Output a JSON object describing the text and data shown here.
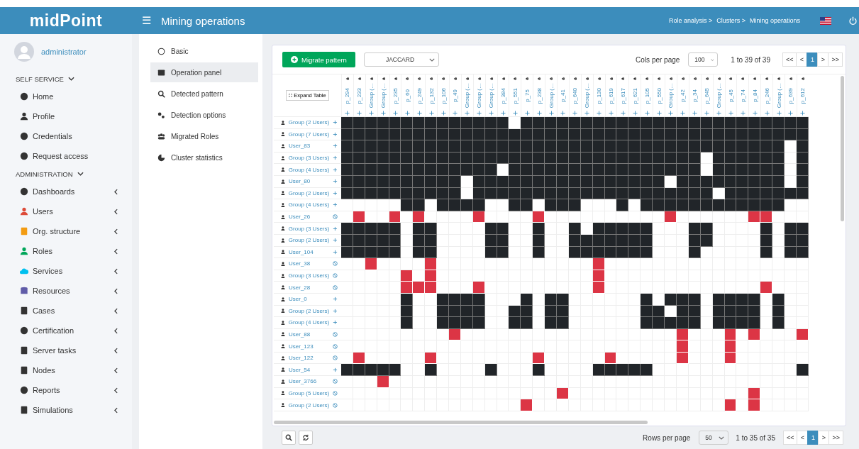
{
  "header": {
    "logo": "midPoint",
    "menu_icon": "☰",
    "title": "Mining operations",
    "breadcrumbs": [
      "Role analysis >",
      "Clusters >",
      "Mining operations"
    ]
  },
  "sidebar": {
    "user": "administrator",
    "sections": [
      {
        "title": "SELF SERVICE",
        "expanded": true,
        "items": [
          {
            "label": "Home",
            "has_submenu": false
          },
          {
            "label": "Profile",
            "has_submenu": false
          },
          {
            "label": "Credentials",
            "has_submenu": false
          },
          {
            "label": "Request access",
            "has_submenu": false
          }
        ]
      },
      {
        "title": "ADMINISTRATION",
        "expanded": true,
        "items": [
          {
            "label": "Dashboards",
            "has_submenu": true
          },
          {
            "label": "Users",
            "has_submenu": true
          },
          {
            "label": "Org. structure",
            "has_submenu": true
          },
          {
            "label": "Roles",
            "has_submenu": true
          },
          {
            "label": "Services",
            "has_submenu": true
          },
          {
            "label": "Resources",
            "has_submenu": true
          },
          {
            "label": "Cases",
            "has_submenu": true
          },
          {
            "label": "Certification",
            "has_submenu": true
          },
          {
            "label": "Server tasks",
            "has_submenu": true
          },
          {
            "label": "Nodes",
            "has_submenu": true
          },
          {
            "label": "Reports",
            "has_submenu": true
          },
          {
            "label": "Simulations",
            "has_submenu": true
          }
        ]
      }
    ]
  },
  "panel_menu": [
    {
      "label": "Basic",
      "selected": false
    },
    {
      "label": "Operation panel",
      "selected": true
    },
    {
      "label": "Detected pattern",
      "selected": false
    },
    {
      "label": "Detection options",
      "selected": false
    },
    {
      "label": "Migrated Roles",
      "selected": false
    },
    {
      "label": "Cluster statistics",
      "selected": false
    }
  ],
  "toolbar": {
    "migrate_button": "Migrate pattern",
    "similarity": "JACCARD",
    "cols_label": "Cols per page",
    "cols_value": "100",
    "range": "1 to 39 of 39",
    "pager": [
      {
        "label": "<<",
        "selected": false
      },
      {
        "label": "<",
        "selected": false
      },
      {
        "label": "1",
        "selected": true
      },
      {
        "label": ">",
        "selected": false
      },
      {
        "label": ">>",
        "selected": false
      }
    ]
  },
  "matrix": {
    "expand_button": "Expand Table",
    "columns": [
      "p_294",
      "p_233",
      "Group (…",
      "Group (…",
      "p_235",
      "p_60",
      "p_249",
      "p_132",
      "p_106",
      "p_49",
      "Group (…",
      "Group (…",
      "Group (…",
      "p_384",
      "p_551",
      "p_75",
      "p_238",
      "Group (…",
      "p_41",
      "p_640",
      "Group (…",
      "p_130",
      "p_619",
      "p_617",
      "p_621",
      "p_105",
      "p_550",
      "Group (…",
      "p_42",
      "p_34",
      "p_645",
      "Group (…",
      "p_45",
      "p_74",
      "p_84",
      "p_246",
      "Group (…",
      "p_639",
      "p_612"
    ],
    "rows": [
      {
        "label": "Group (2 Users)",
        "kind": "add",
        "cells": [
          true,
          true,
          true,
          true,
          true,
          true,
          true,
          true,
          true,
          true,
          true,
          true,
          true,
          true,
          false,
          true,
          true,
          true,
          true,
          true,
          true,
          true,
          true,
          true,
          true,
          true,
          true,
          true,
          true,
          true,
          true,
          true,
          true,
          true,
          true,
          true,
          true,
          true,
          true
        ]
      },
      {
        "label": "Group (7 Users)",
        "kind": "add",
        "cells": [
          true,
          true,
          true,
          true,
          true,
          true,
          true,
          true,
          true,
          true,
          true,
          true,
          true,
          true,
          true,
          true,
          true,
          true,
          true,
          true,
          true,
          true,
          true,
          true,
          true,
          true,
          true,
          true,
          true,
          true,
          true,
          true,
          true,
          true,
          true,
          true,
          true,
          true,
          true
        ]
      },
      {
        "label": "User_83",
        "kind": "add",
        "cells": [
          true,
          true,
          true,
          true,
          true,
          true,
          true,
          true,
          true,
          true,
          true,
          true,
          true,
          true,
          true,
          true,
          true,
          true,
          true,
          true,
          true,
          true,
          true,
          true,
          true,
          true,
          true,
          true,
          true,
          true,
          true,
          true,
          true,
          true,
          true,
          true,
          true,
          false,
          true
        ]
      },
      {
        "label": "Group (3 Users)",
        "kind": "add",
        "cells": [
          true,
          true,
          true,
          true,
          true,
          true,
          true,
          true,
          true,
          true,
          true,
          true,
          true,
          true,
          true,
          true,
          true,
          true,
          true,
          true,
          true,
          true,
          true,
          true,
          true,
          true,
          true,
          true,
          true,
          true,
          false,
          true,
          true,
          true,
          true,
          true,
          true,
          false,
          true
        ]
      },
      {
        "label": "Group (4 Users)",
        "kind": "add",
        "cells": [
          true,
          true,
          true,
          true,
          true,
          true,
          true,
          true,
          true,
          true,
          true,
          true,
          true,
          false,
          true,
          true,
          true,
          true,
          true,
          true,
          true,
          true,
          true,
          true,
          true,
          true,
          true,
          true,
          true,
          true,
          false,
          true,
          true,
          true,
          true,
          true,
          true,
          false,
          true
        ]
      },
      {
        "label": "User_80",
        "kind": "add",
        "cells": [
          true,
          true,
          true,
          true,
          true,
          true,
          true,
          true,
          true,
          true,
          false,
          true,
          true,
          true,
          true,
          true,
          true,
          true,
          true,
          true,
          true,
          true,
          true,
          true,
          true,
          true,
          true,
          false,
          true,
          true,
          true,
          true,
          true,
          true,
          true,
          true,
          true,
          false,
          true
        ]
      },
      {
        "label": "Group (2 Users)",
        "kind": "add",
        "cells": [
          true,
          true,
          true,
          true,
          true,
          true,
          true,
          true,
          true,
          true,
          false,
          true,
          true,
          true,
          true,
          true,
          true,
          true,
          true,
          true,
          true,
          true,
          true,
          true,
          true,
          true,
          true,
          true,
          true,
          true,
          true,
          false,
          true,
          true,
          true,
          true,
          true,
          true,
          true
        ]
      },
      {
        "label": "Group (4 Users)",
        "kind": "add",
        "cells": [
          false,
          false,
          false,
          false,
          false,
          true,
          true,
          false,
          true,
          true,
          true,
          true,
          false,
          false,
          true,
          true,
          false,
          true,
          true,
          true,
          false,
          false,
          false,
          true,
          false,
          true,
          true,
          true,
          true,
          true,
          true,
          true,
          true,
          true,
          true,
          true,
          true,
          false,
          false
        ]
      },
      {
        "label": "User_26",
        "kind": "exclude",
        "cells": [
          false,
          true,
          false,
          false,
          true,
          false,
          true,
          false,
          false,
          false,
          false,
          true,
          false,
          false,
          false,
          false,
          true,
          false,
          false,
          false,
          false,
          false,
          false,
          false,
          false,
          false,
          false,
          true,
          false,
          false,
          false,
          false,
          false,
          false,
          true,
          true,
          false,
          false,
          false
        ]
      },
      {
        "label": "Group (3 Users)",
        "kind": "add",
        "cells": [
          true,
          true,
          true,
          true,
          true,
          false,
          true,
          true,
          false,
          false,
          false,
          false,
          true,
          true,
          false,
          false,
          true,
          false,
          false,
          true,
          false,
          true,
          true,
          true,
          true,
          true,
          false,
          false,
          false,
          true,
          true,
          false,
          false,
          false,
          false,
          true,
          false,
          true,
          true
        ]
      },
      {
        "label": "Group (2 Users)",
        "kind": "add",
        "cells": [
          true,
          true,
          true,
          true,
          true,
          false,
          true,
          true,
          false,
          false,
          false,
          false,
          true,
          true,
          false,
          false,
          true,
          false,
          false,
          true,
          true,
          true,
          true,
          true,
          true,
          true,
          false,
          false,
          false,
          true,
          true,
          false,
          false,
          false,
          false,
          true,
          false,
          true,
          true
        ]
      },
      {
        "label": "User_104",
        "kind": "add",
        "cells": [
          true,
          true,
          true,
          true,
          true,
          false,
          true,
          true,
          false,
          false,
          false,
          false,
          true,
          true,
          false,
          false,
          true,
          false,
          false,
          true,
          true,
          true,
          true,
          true,
          true,
          true,
          false,
          false,
          false,
          true,
          false,
          false,
          false,
          false,
          false,
          true,
          false,
          true,
          true
        ]
      },
      {
        "label": "User_38",
        "kind": "exclude",
        "cells": [
          false,
          false,
          true,
          false,
          false,
          false,
          false,
          true,
          false,
          false,
          false,
          false,
          false,
          false,
          false,
          false,
          false,
          false,
          false,
          false,
          false,
          true,
          false,
          false,
          false,
          false,
          false,
          false,
          false,
          false,
          false,
          false,
          false,
          false,
          false,
          false,
          false,
          false,
          false
        ]
      },
      {
        "label": "Group (3 Users)",
        "kind": "exclude",
        "cells": [
          false,
          false,
          false,
          false,
          false,
          true,
          false,
          true,
          false,
          false,
          false,
          false,
          false,
          false,
          false,
          false,
          false,
          false,
          false,
          false,
          false,
          true,
          false,
          false,
          false,
          false,
          false,
          false,
          false,
          false,
          false,
          false,
          false,
          false,
          false,
          false,
          false,
          false,
          false
        ]
      },
      {
        "label": "User_28",
        "kind": "exclude",
        "cells": [
          false,
          false,
          false,
          false,
          false,
          true,
          true,
          true,
          false,
          false,
          false,
          true,
          false,
          false,
          false,
          false,
          false,
          false,
          false,
          false,
          false,
          true,
          false,
          false,
          false,
          false,
          false,
          false,
          false,
          false,
          false,
          false,
          false,
          false,
          false,
          true,
          false,
          false,
          false
        ]
      },
      {
        "label": "User_0",
        "kind": "add",
        "cells": [
          false,
          false,
          false,
          false,
          false,
          true,
          false,
          false,
          true,
          true,
          true,
          true,
          false,
          false,
          false,
          true,
          false,
          true,
          true,
          false,
          false,
          false,
          false,
          false,
          false,
          true,
          false,
          true,
          true,
          true,
          false,
          true,
          true,
          true,
          true,
          false,
          true,
          false,
          false
        ]
      },
      {
        "label": "Group (2 Users)",
        "kind": "add",
        "cells": [
          false,
          false,
          false,
          false,
          false,
          true,
          false,
          false,
          true,
          true,
          true,
          true,
          false,
          false,
          true,
          true,
          false,
          true,
          true,
          false,
          false,
          false,
          false,
          false,
          false,
          true,
          true,
          false,
          true,
          true,
          false,
          true,
          true,
          true,
          true,
          false,
          true,
          false,
          false
        ]
      },
      {
        "label": "Group (4 Users)",
        "kind": "add",
        "cells": [
          false,
          false,
          false,
          false,
          false,
          true,
          false,
          false,
          true,
          true,
          true,
          true,
          false,
          false,
          true,
          true,
          false,
          true,
          true,
          false,
          false,
          false,
          false,
          false,
          false,
          true,
          true,
          true,
          true,
          true,
          false,
          true,
          true,
          true,
          true,
          false,
          true,
          false,
          false
        ]
      },
      {
        "label": "User_88",
        "kind": "exclude",
        "cells": [
          false,
          false,
          false,
          false,
          false,
          false,
          false,
          false,
          false,
          true,
          false,
          false,
          false,
          false,
          false,
          false,
          false,
          false,
          false,
          false,
          false,
          false,
          false,
          false,
          false,
          false,
          false,
          false,
          true,
          false,
          false,
          false,
          true,
          false,
          true,
          false,
          false,
          false,
          true
        ]
      },
      {
        "label": "User_123",
        "kind": "exclude",
        "cells": [
          false,
          false,
          false,
          false,
          false,
          false,
          false,
          false,
          false,
          false,
          false,
          false,
          false,
          false,
          false,
          false,
          false,
          false,
          false,
          false,
          false,
          false,
          false,
          false,
          false,
          false,
          false,
          false,
          true,
          false,
          false,
          false,
          true,
          false,
          false,
          false,
          false,
          false,
          false
        ]
      },
      {
        "label": "User_122",
        "kind": "exclude",
        "cells": [
          false,
          true,
          false,
          false,
          false,
          false,
          false,
          true,
          false,
          false,
          false,
          false,
          false,
          false,
          false,
          false,
          true,
          false,
          false,
          false,
          false,
          false,
          true,
          false,
          false,
          false,
          false,
          false,
          true,
          false,
          false,
          false,
          true,
          false,
          false,
          false,
          false,
          false,
          false
        ]
      },
      {
        "label": "User_54",
        "kind": "add",
        "cells": [
          true,
          true,
          true,
          true,
          true,
          false,
          false,
          true,
          false,
          false,
          false,
          false,
          true,
          false,
          false,
          false,
          true,
          false,
          false,
          false,
          false,
          true,
          true,
          true,
          true,
          true,
          false,
          false,
          false,
          false,
          false,
          false,
          false,
          false,
          false,
          false,
          false,
          false,
          true
        ]
      },
      {
        "label": "User_3766",
        "kind": "exclude",
        "cells": [
          false,
          false,
          false,
          true,
          false,
          false,
          false,
          false,
          false,
          false,
          false,
          false,
          false,
          false,
          false,
          false,
          false,
          false,
          false,
          false,
          false,
          false,
          false,
          false,
          false,
          false,
          false,
          false,
          false,
          false,
          false,
          false,
          false,
          false,
          false,
          false,
          false,
          false,
          false
        ]
      },
      {
        "label": "Group (5 Users)",
        "kind": "exclude",
        "cells": [
          false,
          false,
          false,
          false,
          false,
          false,
          false,
          false,
          false,
          false,
          false,
          false,
          false,
          false,
          false,
          false,
          false,
          false,
          true,
          false,
          false,
          false,
          false,
          false,
          false,
          false,
          false,
          false,
          false,
          false,
          false,
          false,
          false,
          false,
          true,
          false,
          false,
          false,
          false
        ]
      },
      {
        "label": "Group (2 Users)",
        "kind": "exclude",
        "cells": [
          false,
          false,
          false,
          false,
          false,
          false,
          false,
          false,
          false,
          false,
          false,
          false,
          false,
          false,
          false,
          true,
          false,
          false,
          false,
          false,
          false,
          false,
          false,
          false,
          false,
          false,
          false,
          false,
          false,
          false,
          false,
          false,
          true,
          false,
          true,
          false,
          false,
          false,
          false
        ]
      }
    ]
  },
  "footer": {
    "rows_label": "Rows per page",
    "rows_value": "50",
    "range": "1 to 35 of 35",
    "pager": [
      {
        "label": "<<",
        "selected": false
      },
      {
        "label": "<",
        "selected": false
      },
      {
        "label": "1",
        "selected": true
      },
      {
        "label": ">",
        "selected": false
      },
      {
        "label": ">>",
        "selected": false
      }
    ]
  }
}
